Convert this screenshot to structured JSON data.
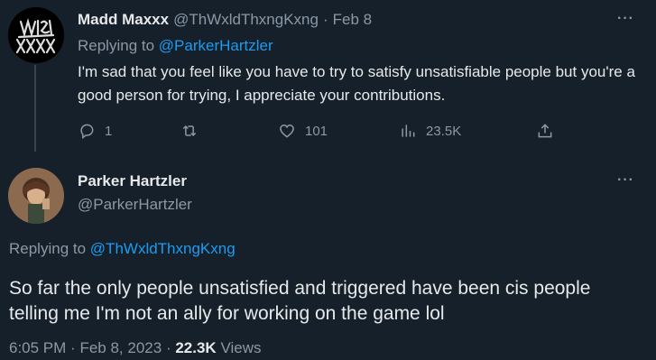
{
  "tweet1": {
    "author_name": "Madd Maxxx",
    "author_handle": "@ThWxldThxngKxng",
    "separator": "·",
    "date": "Feb 8",
    "replying_prefix": "Replying to",
    "replying_handle": "@ParkerHartzler",
    "text": "I'm sad that you feel like you have to try to satisfy unsatisfiable people but you're a good person for trying, I appreciate your contributions.",
    "replies": "1",
    "likes": "101",
    "views": "23.5K"
  },
  "tweet2": {
    "author_name": "Parker Hartzler",
    "author_handle": "@ParkerHartzler",
    "replying_prefix": "Replying to",
    "replying_handle": "@ThWxldThxngKxng",
    "text": "So far the only people unsatisfied and triggered have been cis people telling me I'm not an ally for working on the game lol",
    "time": "6:05 PM",
    "separator": "·",
    "date": "Feb 8, 2023",
    "views_count": "22.3K",
    "views_label": "Views"
  },
  "more_label": "···",
  "colors": {
    "background": "#15202b",
    "text": "#e7e9ea",
    "muted": "#8b98a5",
    "link": "#1d9bf0"
  },
  "icons": [
    "reply-icon",
    "retweet-icon",
    "like-icon",
    "views-icon",
    "share-icon"
  ]
}
